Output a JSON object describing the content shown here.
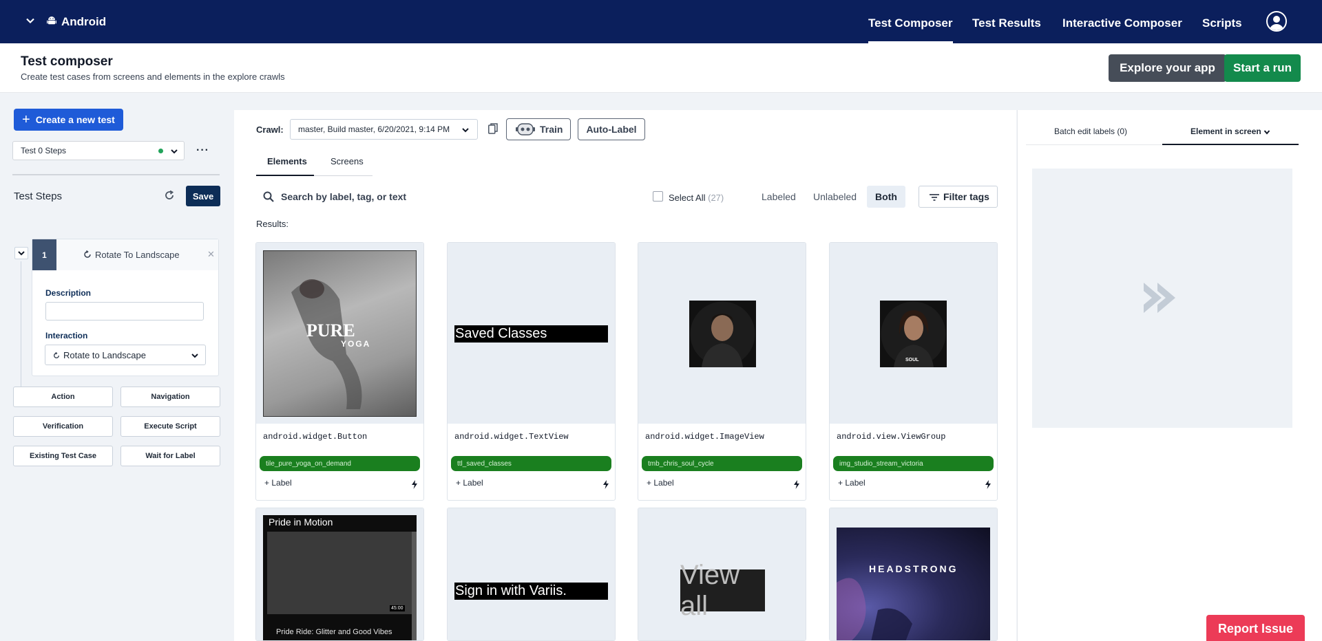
{
  "topnav": {
    "app_name": "Android",
    "tabs": [
      "Test Composer",
      "Test Results",
      "Interactive Composer",
      "Scripts"
    ],
    "active_tab": "Test Composer"
  },
  "header": {
    "title": "Test composer",
    "subtitle": "Create test cases from screens and elements in the explore crawls",
    "explore_label": "Explore your app",
    "run_label": "Start a run"
  },
  "sidebar": {
    "create_label": "Create a new test",
    "test_select_value": "Test 0 Steps",
    "steps_label": "Test Steps",
    "save_label": "Save",
    "step": {
      "number": "1",
      "title": "Rotate To Landscape",
      "description_label": "Description",
      "description_value": "",
      "interaction_label": "Interaction",
      "interaction_value": "Rotate to Landscape"
    },
    "add_buttons": [
      "Action",
      "Navigation",
      "Verification",
      "Execute Script",
      "Existing Test Case",
      "Wait for Label"
    ]
  },
  "center": {
    "crawl_label": "Crawl:",
    "crawl_value": "master, Build master, 6/20/2021, 9:14 PM",
    "train_label": "Train",
    "autolabel_label": "Auto-Label",
    "subtabs": [
      "Elements",
      "Screens"
    ],
    "search_placeholder": "Search by label, tag, or text",
    "select_all_label": "Select All",
    "select_all_count": "(27)",
    "filters": [
      "Labeled",
      "Unlabeled",
      "Both"
    ],
    "active_filter": "Both",
    "filter_tags_label": "Filter tags",
    "results_label": "Results:",
    "add_label_text": "+ Label",
    "cards": [
      {
        "class_name": "android.widget.Button",
        "tag": "tile_pure_yoga_on_demand",
        "thumb_text": "PURE",
        "thumb_subtext": "YOGA"
      },
      {
        "class_name": "android.widget.TextView",
        "tag": "ttl_saved_classes",
        "thumb_text": "Saved Classes"
      },
      {
        "class_name": "android.widget.ImageView",
        "tag": "tmb_chris_soul_cycle"
      },
      {
        "class_name": "android.view.ViewGroup",
        "tag": "img_studio_stream_victoria",
        "thumb_text": "SOUL"
      },
      {
        "thumb_text": "Pride in Motion",
        "thumb_subtext": "Pride Ride: Glitter and Good Vibes",
        "duration": "45:00"
      },
      {
        "thumb_text": "Sign in with Variis."
      },
      {
        "thumb_text": "View all"
      },
      {
        "thumb_text": "HEADSTRONG"
      }
    ]
  },
  "right_panel": {
    "tabs": [
      "Batch edit labels (0)",
      "Element in screen"
    ],
    "active_tab": "Element in screen"
  },
  "report_label": "Report Issue",
  "colors": {
    "nav_bg": "#0b1f5c",
    "primary_blue": "#1f5bd8",
    "run_green": "#138a4c",
    "tag_green": "#1a7f1f",
    "report_red": "#ec3b57"
  }
}
